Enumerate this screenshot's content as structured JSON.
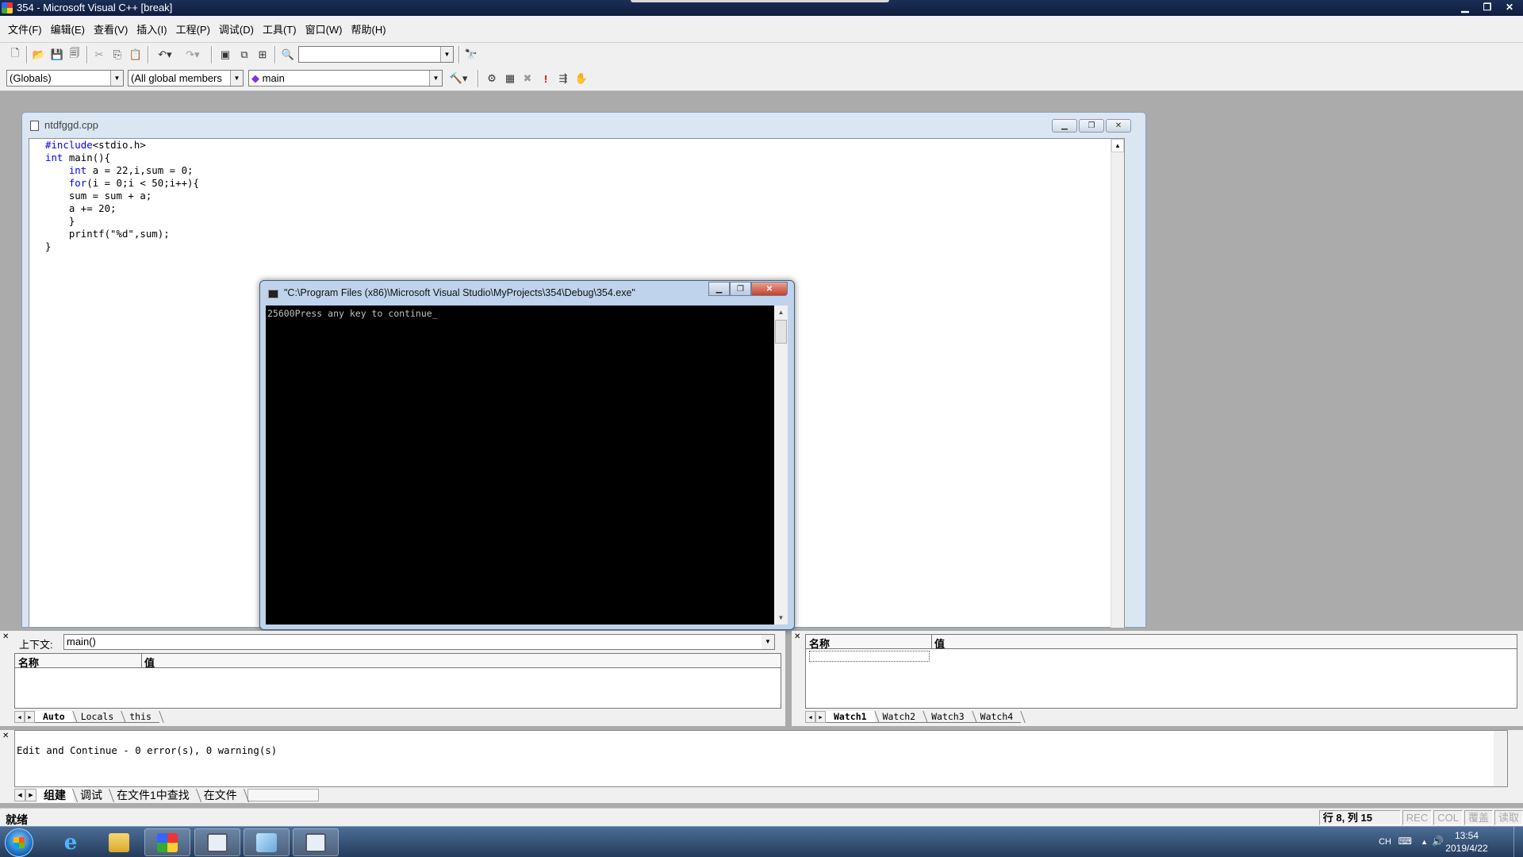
{
  "window": {
    "title": "354 - Microsoft Visual C++ [break]",
    "minimize": "▁",
    "restore": "❐",
    "close": "✕"
  },
  "menu": [
    "文件(F)",
    "编辑(E)",
    "查看(V)",
    "插入(I)",
    "工程(P)",
    "调试(D)",
    "工具(T)",
    "窗口(W)",
    "帮助(H)"
  ],
  "toolbar2": {
    "scope_combo": "(Globals)",
    "members_combo": "(All global members",
    "function_combo": "main"
  },
  "editor": {
    "filename": "ntdfggd.cpp",
    "code_lines": [
      [
        {
          "t": "#include",
          "k": true
        },
        {
          "t": "<stdio.h>",
          "k": false
        }
      ],
      [
        {
          "t": "int",
          "k": true
        },
        {
          "t": " main(){",
          "k": false
        }
      ],
      [
        {
          "t": "    ",
          "k": false
        },
        {
          "t": "int",
          "k": true
        },
        {
          "t": " a = 22,i,sum = 0;",
          "k": false
        }
      ],
      [
        {
          "t": "    ",
          "k": false
        },
        {
          "t": "for",
          "k": true
        },
        {
          "t": "(i = 0;i < 50;i++){",
          "k": false
        }
      ],
      [
        {
          "t": "    sum = sum + a;",
          "k": false
        }
      ],
      [
        {
          "t": "    a += 20;",
          "k": false
        }
      ],
      [
        {
          "t": "    }",
          "k": false
        }
      ],
      [
        {
          "t": "    printf(\"%d\",sum);",
          "k": false
        }
      ],
      [
        {
          "t": "}",
          "k": false
        }
      ]
    ]
  },
  "console": {
    "title": "\"C:\\Program Files (x86)\\Microsoft Visual Studio\\MyProjects\\354\\Debug\\354.exe\"",
    "output": "25600Press any key to continue_"
  },
  "variables_pane": {
    "context_label": "上下文:",
    "context_value": "main()",
    "col_name": "名称",
    "col_value": "值",
    "tabs": [
      "Auto",
      "Locals",
      "this"
    ]
  },
  "watch_pane": {
    "col_name": "名称",
    "col_value": "值",
    "tabs": [
      "Watch1",
      "Watch2",
      "Watch3",
      "Watch4"
    ]
  },
  "output_pane": {
    "text": "Edit and Continue - 0 error(s), 0 warning(s)",
    "tabs": [
      "组建",
      "调试",
      "在文件1中查找",
      "在文件"
    ]
  },
  "statusbar": {
    "ready": "就绪",
    "position": "行 8, 列 15",
    "rec": "REC",
    "col": "COL",
    "ovr": "覆盖",
    "read": "读取"
  },
  "taskbar": {
    "lang": "CH",
    "time": "13:54",
    "date": "2019/4/22"
  }
}
